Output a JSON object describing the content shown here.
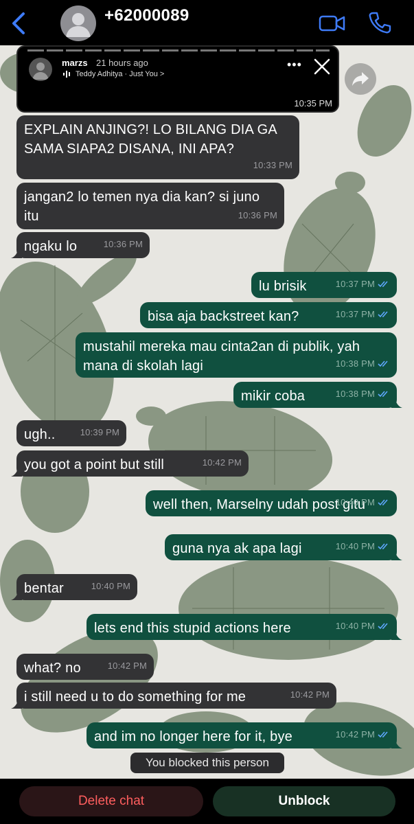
{
  "header": {
    "contact_name": "+62000089",
    "back_icon": "chevron-left-icon",
    "video_icon": "video-camera-icon",
    "call_icon": "phone-icon",
    "accent_color": "#3e7bf7"
  },
  "story_reply": {
    "username": "marzs",
    "posted_ago": "21 hours ago",
    "music": "Teddy Adhitya · Just You >",
    "time": "10:35 PM"
  },
  "messages": [
    {
      "direction": "in",
      "text": "EXPLAIN ANJING?! LO BILANG DIA GA\nSAMA SIAPA2 DISANA, INI APA?",
      "time": "10:33 PM"
    },
    {
      "direction": "in",
      "text": "jangan2 lo temen nya dia kan? si juno\nitu",
      "time": "10:36 PM"
    },
    {
      "direction": "in",
      "text": "ngaku lo",
      "time": "10:36 PM"
    },
    {
      "direction": "out",
      "text": "lu brisik",
      "time": "10:37 PM"
    },
    {
      "direction": "out",
      "text": "bisa aja backstreet kan?",
      "time": "10:37 PM"
    },
    {
      "direction": "out",
      "text": "mustahil mereka mau cinta2an di publik, yah\nmana di skolah lagi",
      "time": "10:38 PM"
    },
    {
      "direction": "out",
      "text": "mikir coba",
      "time": "10:38 PM"
    },
    {
      "direction": "in",
      "text": "ugh..",
      "time": "10:39 PM"
    },
    {
      "direction": "in",
      "text": "you got a point but still",
      "time": "10:42 PM"
    },
    {
      "direction": "out",
      "text": "well then, Marselny udah post gitu",
      "time": "10:40 PM"
    },
    {
      "direction": "out",
      "text": "guna nya ak apa lagi",
      "time": "10:40 PM"
    },
    {
      "direction": "in",
      "text": "bentar",
      "time": "10:40 PM"
    },
    {
      "direction": "out",
      "text": "lets end this stupid actions here",
      "time": "10:40 PM"
    },
    {
      "direction": "in",
      "text": "what? no",
      "time": "10:42 PM"
    },
    {
      "direction": "in",
      "text": "i still need u to do something for me",
      "time": "10:42 PM"
    },
    {
      "direction": "out",
      "text": "and im no longer here for it, bye",
      "time": "10:42 PM"
    }
  ],
  "system_message": "You blocked this person",
  "footer": {
    "delete_label": "Delete chat",
    "unblock_label": "Unblock"
  }
}
